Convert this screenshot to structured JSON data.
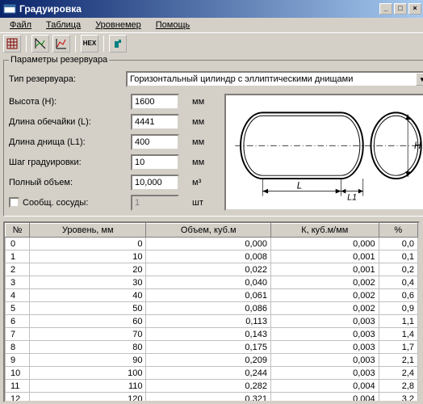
{
  "window": {
    "title": "Градуировка"
  },
  "menu": {
    "file": "Файл",
    "table": "Таблица",
    "level": "Уровнемер",
    "help": "Помощь"
  },
  "params": {
    "legend": "Параметры резервуара",
    "type_label": "Тип резервуара:",
    "type_value": "Горизонтальный цилиндр с эллиптическими днищами",
    "height_label": "Высота (H):",
    "height_value": "1600",
    "height_unit": "мм",
    "barrel_label": "Длина обечайки (L):",
    "barrel_value": "4441",
    "barrel_unit": "мм",
    "endcap_label": "Длина днища (L1):",
    "endcap_value": "400",
    "endcap_unit": "мм",
    "step_label": "Шаг градуировки:",
    "step_value": "10",
    "step_unit": "мм",
    "volume_label": "Полный объем:",
    "volume_value": "10,000",
    "volume_unit": "м³",
    "connected_label": "Сообщ. сосуды:",
    "connected_value": "1",
    "connected_unit": "шт"
  },
  "table": {
    "columns": [
      "№",
      "Уровень, мм",
      "Объем, куб.м",
      "К, куб.м/мм",
      "%"
    ],
    "rows": [
      [
        "0",
        "0",
        "0,000",
        "0,000",
        "0,0"
      ],
      [
        "1",
        "10",
        "0,008",
        "0,001",
        "0,1"
      ],
      [
        "2",
        "20",
        "0,022",
        "0,001",
        "0,2"
      ],
      [
        "3",
        "30",
        "0,040",
        "0,002",
        "0,4"
      ],
      [
        "4",
        "40",
        "0,061",
        "0,002",
        "0,6"
      ],
      [
        "5",
        "50",
        "0,086",
        "0,002",
        "0,9"
      ],
      [
        "6",
        "60",
        "0,113",
        "0,003",
        "1,1"
      ],
      [
        "7",
        "70",
        "0,143",
        "0,003",
        "1,4"
      ],
      [
        "8",
        "80",
        "0,175",
        "0,003",
        "1,7"
      ],
      [
        "9",
        "90",
        "0,209",
        "0,003",
        "2,1"
      ],
      [
        "10",
        "100",
        "0,244",
        "0,003",
        "2,4"
      ],
      [
        "11",
        "110",
        "0,282",
        "0,004",
        "2,8"
      ],
      [
        "12",
        "120",
        "0,321",
        "0,004",
        "3,2"
      ]
    ]
  },
  "diagram": {
    "L": "L",
    "L1": "L1",
    "H": "H"
  }
}
